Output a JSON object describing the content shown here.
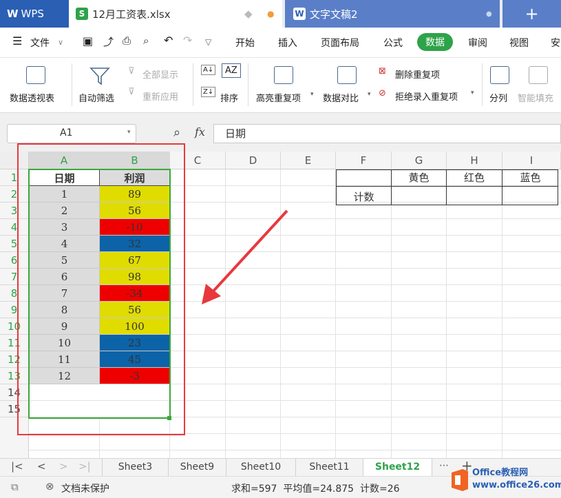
{
  "tabs": {
    "wps": "WPS",
    "file": "12月工资表.xlsx",
    "doc": "文字文稿2",
    "plus": "+"
  },
  "menu": {
    "file": "文件",
    "items": [
      "开始",
      "插入",
      "页面布局",
      "公式",
      "数据",
      "审阅",
      "视图",
      "安"
    ]
  },
  "ribbon": {
    "pivot": "数据透视表",
    "autofilter": "自动筛选",
    "show_all": "全部显示",
    "reapply": "重新应用",
    "sort": "排序",
    "highlight_dup": "高亮重复项",
    "compare": "数据对比",
    "delete_dup": "删除重复项",
    "reject_dup": "拒绝录入重复项",
    "split": "分列",
    "smart_fill": "智能填充"
  },
  "formula_bar": {
    "cell_ref": "A1",
    "fx": "fx",
    "content": "日期"
  },
  "columns": [
    "A",
    "B",
    "C",
    "D",
    "E",
    "F",
    "G",
    "H",
    "I"
  ],
  "rows": [
    "1",
    "2",
    "3",
    "4",
    "5",
    "6",
    "7",
    "8",
    "9",
    "10",
    "11",
    "12",
    "13",
    "14",
    "15"
  ],
  "table": {
    "header": [
      "日期",
      "利润"
    ],
    "rows": [
      {
        "date": "1",
        "profit": "89",
        "color": "#e0dc00"
      },
      {
        "date": "2",
        "profit": "56",
        "color": "#e0dc00"
      },
      {
        "date": "3",
        "profit": "-10",
        "color": "#ee0000"
      },
      {
        "date": "4",
        "profit": "32",
        "color": "#0c63a8"
      },
      {
        "date": "5",
        "profit": "67",
        "color": "#e0dc00"
      },
      {
        "date": "6",
        "profit": "98",
        "color": "#e0dc00"
      },
      {
        "date": "7",
        "profit": "-34",
        "color": "#ee0000"
      },
      {
        "date": "8",
        "profit": "56",
        "color": "#e0dc00"
      },
      {
        "date": "9",
        "profit": "100",
        "color": "#e0dc00"
      },
      {
        "date": "10",
        "profit": "23",
        "color": "#0c63a8"
      },
      {
        "date": "11",
        "profit": "45",
        "color": "#0c63a8"
      },
      {
        "date": "12",
        "profit": "-3",
        "color": "#ee0000"
      }
    ]
  },
  "count_table": {
    "headers": [
      "黄色",
      "红色",
      "蓝色"
    ],
    "row_label": "计数"
  },
  "sheets": [
    "Sheet3",
    "Sheet9",
    "Sheet10",
    "Sheet11",
    "Sheet12"
  ],
  "active_sheet": "Sheet12",
  "status": {
    "protect": "文档未保护",
    "summary": "求和=597  平均值=24.875  计数=26"
  },
  "watermark": "Office教程网 www.office26.com",
  "colors": {
    "accent": "#2ea34a",
    "annotation": "#e8383d",
    "yellow": "#e0dc00",
    "red": "#ee0000",
    "blue": "#0c63a8"
  }
}
